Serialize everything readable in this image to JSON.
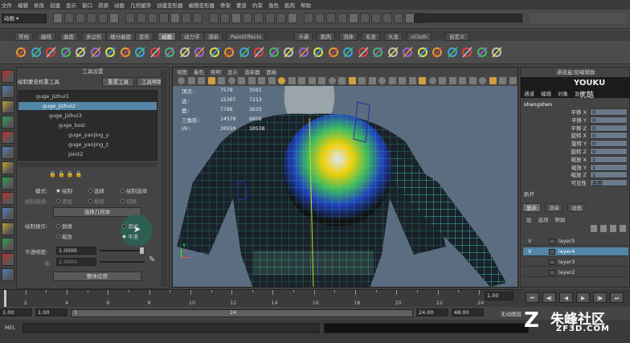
{
  "menu": [
    "文件",
    "编辑",
    "修改",
    "创建",
    "显示",
    "窗口",
    "资源",
    "动画",
    "几何缓存",
    "创建变形器",
    "编辑变形器",
    "骨架",
    "蒙皮",
    "约束",
    "角色",
    "肌肉",
    "帮助"
  ],
  "mode_select": "动画",
  "shelf_tabs": [
    "常规",
    "曲线",
    "曲面",
    "多边形",
    "细分曲面",
    "变形",
    "动画",
    "动力学",
    "渲染",
    "PaintEffects",
    "卡通",
    "肌肉",
    "流体",
    "毛发",
    "头发",
    "nCloth",
    "自定义"
  ],
  "shelf_active": "动画",
  "tool_panel": {
    "title": "工具设置",
    "tool_name": "绘制蒙皮权重工具",
    "reset_button": "重置工具",
    "help_button": "工具帮助",
    "tree": [
      "guge_jizhui1",
      "guge_jizhui2",
      "guge_jizhui3",
      "guge_bozi",
      "guge_yanjing_y",
      "guge_yanjing_z",
      "joint2"
    ],
    "tree_selected": "guge_jizhui2",
    "mode_label": "模式:",
    "modes": [
      "绘制",
      "选择",
      "绘制选择"
    ],
    "select_label": "绘制选择:",
    "select_opts": [
      "添加",
      "移除",
      "切换"
    ],
    "select_geo_button": "选择几何体",
    "op_label": "绘制操作:",
    "ops": [
      "替换",
      "添加",
      "缩放",
      "平滑"
    ],
    "opacity_label": "不透明度:",
    "opacity_value": "1.0000",
    "value_label": "值:",
    "value_value": "1.0000",
    "bottom_button": "整体应用"
  },
  "viewport": {
    "menu": [
      "视图",
      "着色",
      "照明",
      "显示",
      "渲染器",
      "面板"
    ],
    "hud": [
      {
        "label": "顶点:",
        "a": "7578",
        "b": "3591"
      },
      {
        "label": "边:",
        "a": "15307",
        "b": "7213"
      },
      {
        "label": "面:",
        "a": "7786",
        "b": "3625"
      },
      {
        "label": "三角形:",
        "a": "14570",
        "b": "6858"
      },
      {
        "label": "UV:",
        "a": "20559",
        "b": "10538"
      }
    ],
    "axis_y": "Y",
    "axis_z": "Z"
  },
  "channel_box": {
    "title": "通道盒/层编辑器",
    "menu": [
      "通道",
      "编辑",
      "对象",
      "显示"
    ],
    "object": "shangshen",
    "attrs": [
      {
        "name": "平移 X",
        "value": "0"
      },
      {
        "name": "平移 Y",
        "value": "0"
      },
      {
        "name": "平移 Z",
        "value": "0"
      },
      {
        "name": "旋转 X",
        "value": "0"
      },
      {
        "name": "旋转 Y",
        "value": "0"
      },
      {
        "name": "旋转 Z",
        "value": "0"
      },
      {
        "name": "缩放 X",
        "value": "1"
      },
      {
        "name": "缩放 Y",
        "value": "1"
      },
      {
        "name": "缩放 Z",
        "value": "1"
      },
      {
        "name": "可见性",
        "value": "启用"
      }
    ],
    "inputs_label": "断开",
    "layer_tabs": [
      "显示",
      "渲染",
      "动画"
    ],
    "layer_menu": [
      "层",
      "选项",
      "帮助"
    ],
    "layers": [
      "layer5",
      "layer4",
      "layer3",
      "layer2"
    ],
    "layer_selected": "layer4",
    "layer_v": "V"
  },
  "timeline": {
    "ticks": [
      "1",
      "2",
      "4",
      "6",
      "8",
      "10",
      "12",
      "14",
      "16",
      "18",
      "20",
      "22",
      "24"
    ],
    "current_frame": "1.00"
  },
  "range": {
    "start": "1.00",
    "inner_start": "1.00",
    "inner_slider_label": "1",
    "inner_slider_end": "24",
    "inner_end": "24.00",
    "end": "48.00",
    "anim_layer": "无动画层"
  },
  "mel_label": "MEL",
  "watermark": {
    "youku": "YOUKU",
    "youku_cn": "优酷",
    "site_cn": "朱峰社区",
    "site_url": "ZF3D.COM"
  }
}
